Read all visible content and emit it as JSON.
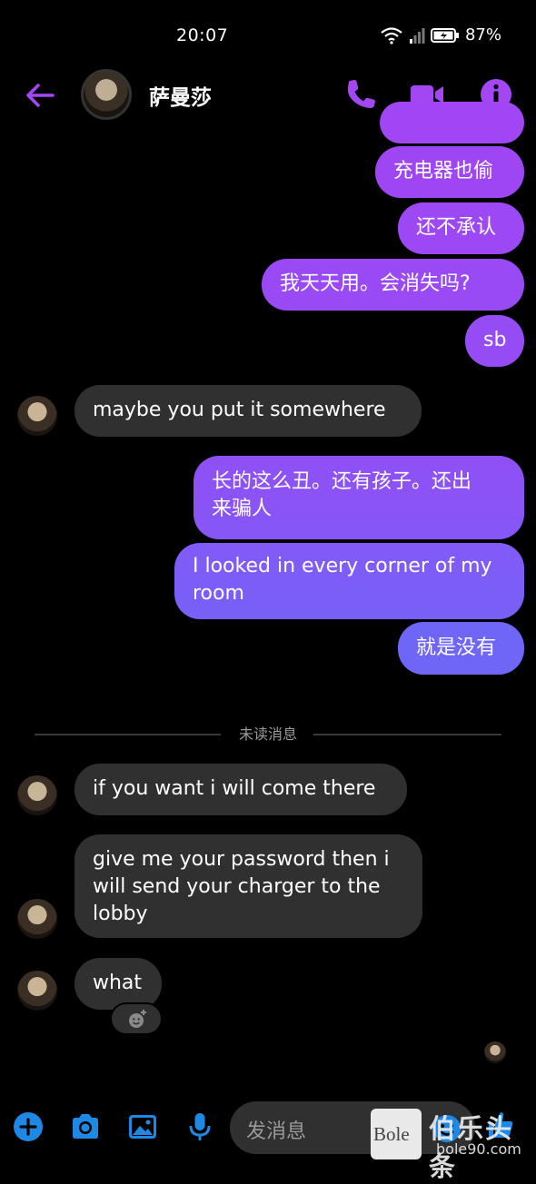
{
  "status_bar": {
    "time": "20:07",
    "battery": "87%"
  },
  "header": {
    "contact_name": "萨曼莎"
  },
  "messages": [
    {
      "dir": "out",
      "text": "充电器也偷"
    },
    {
      "dir": "out",
      "text": "还不承认"
    },
    {
      "dir": "out",
      "text": "我天天用。会消失吗?"
    },
    {
      "dir": "out",
      "text": "sb"
    },
    {
      "dir": "in",
      "text": "maybe you put it somewhere"
    },
    {
      "dir": "out",
      "text": "长的这么丑。还有孩子。还出\n来骗人"
    },
    {
      "dir": "out",
      "text": "I looked in every corner of my\nroom"
    },
    {
      "dir": "out",
      "text": "就是没有"
    },
    {
      "dir": "in",
      "text": "if you want i will come there"
    },
    {
      "dir": "in",
      "text": "give me your password then i\nwill send your charger to the\nlobby"
    },
    {
      "dir": "in",
      "text": "what"
    }
  ],
  "divider_label": "未读消息",
  "composer": {
    "placeholder": "发消息"
  },
  "watermark": {
    "brand": "Bole",
    "site": "bole90.com",
    "cn": "伯乐头条"
  },
  "colors": {
    "accent": "#a347f5",
    "bubble_top": "#9d45f2",
    "bubble_bottom": "#6a6cf8",
    "incoming": "#303030"
  }
}
